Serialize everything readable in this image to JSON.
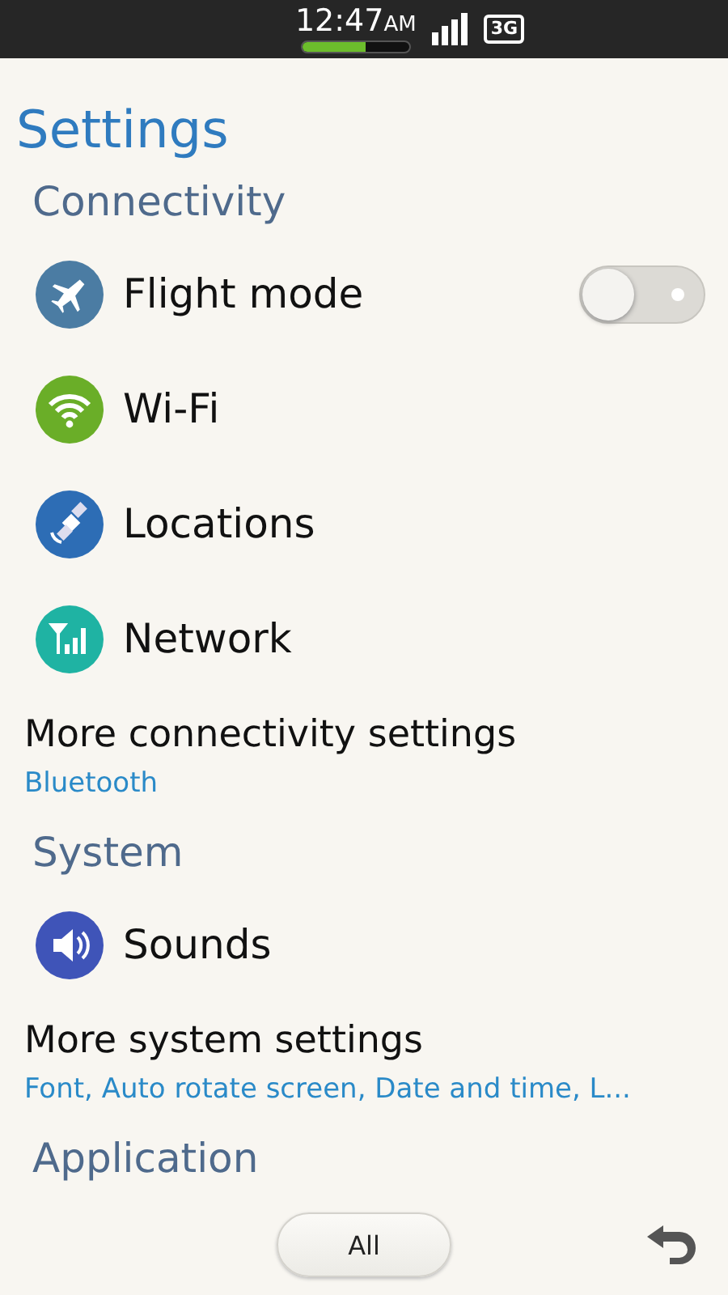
{
  "status_bar": {
    "time": "12:47",
    "ampm": "AM",
    "network": "3G",
    "battery": {
      "level": 0.6
    }
  },
  "title": "Settings",
  "sections": [
    {
      "header": "Connectivity",
      "items": [
        {
          "kind": "toggle",
          "label": "Flight mode",
          "on": false
        },
        {
          "kind": "link",
          "label": "Wi-Fi"
        },
        {
          "kind": "link",
          "label": "Locations"
        },
        {
          "kind": "link",
          "label": "Network"
        },
        {
          "kind": "more",
          "label": "More connectivity settings",
          "subtitle": "Bluetooth"
        }
      ]
    },
    {
      "header": "System",
      "items": [
        {
          "kind": "link",
          "label": "Sounds"
        },
        {
          "kind": "more",
          "label": "More system settings",
          "subtitle": "Font, Auto rotate screen, Date and time, L..."
        }
      ]
    },
    {
      "header": "Application"
    }
  ],
  "bottom_bar": {
    "button": "All"
  }
}
